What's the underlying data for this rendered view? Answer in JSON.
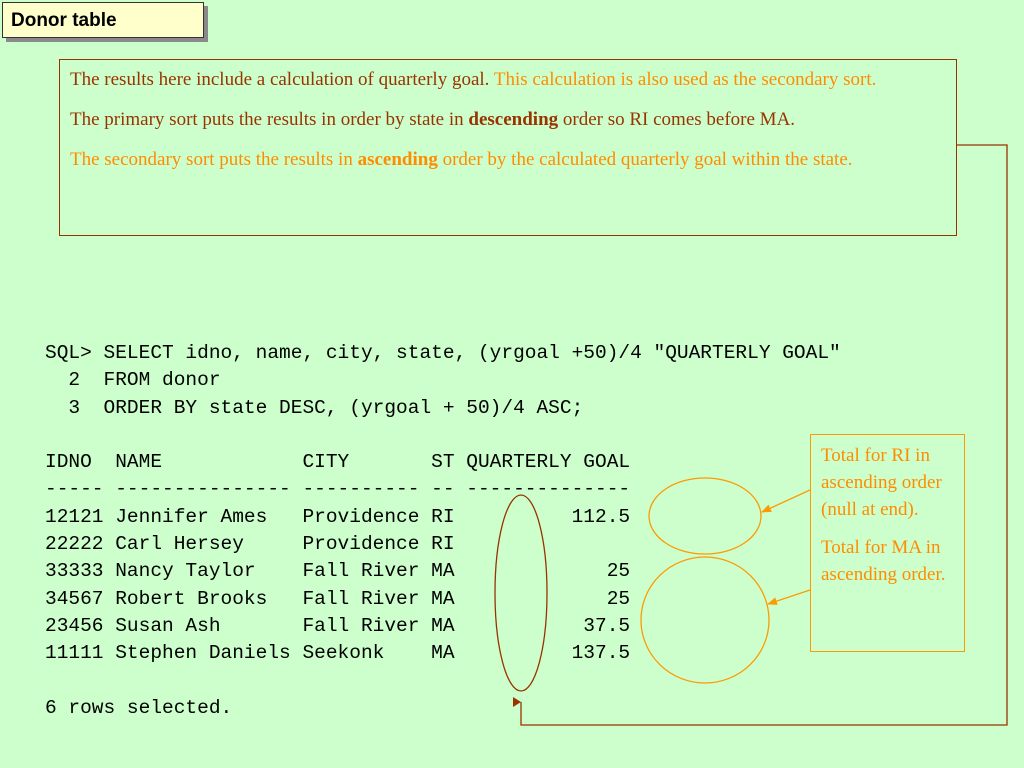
{
  "title": "Donor table",
  "notes": {
    "p1_dark": "The results here include a calculation of quarterly goal.",
    "p1_orange": "This calculation is also used as the secondary sort.",
    "p2_before": "The primary sort puts the results in order by state in",
    "p2_bold": "descending",
    "p2_after": "order so RI comes before MA.",
    "p3_before": "The secondary sort puts the results in",
    "p3_bold": "ascending",
    "p3_after": "order by the calculated quarterly goal within the state."
  },
  "sql": {
    "lines": [
      "SQL> SELECT idno, name, city, state, (yrgoal +50)/4 \"QUARTERLY GOAL\"",
      "  2  FROM donor",
      "  3  ORDER BY state DESC, (yrgoal + 50)/4 ASC;",
      "",
      "IDNO  NAME            CITY       ST QUARTERLY GOAL",
      "----- --------------- ---------- -- --------------",
      "12121 Jennifer Ames   Providence RI          112.5",
      "22222 Carl Hersey     Providence RI",
      "33333 Nancy Taylor    Fall River MA             25",
      "34567 Robert Brooks   Fall River MA             25",
      "23456 Susan Ash       Fall River MA           37.5",
      "11111 Stephen Daniels Seekonk    MA          137.5",
      "",
      "6 rows selected."
    ]
  },
  "side_notes": {
    "ri": "Total for RI in ascending order (null at end).",
    "ma": "Total for MA in ascending order."
  },
  "colors": {
    "background": "#ccffcc",
    "dark_text": "#993300",
    "orange_text": "#ff8c00",
    "title_fill": "#ffffcc"
  }
}
